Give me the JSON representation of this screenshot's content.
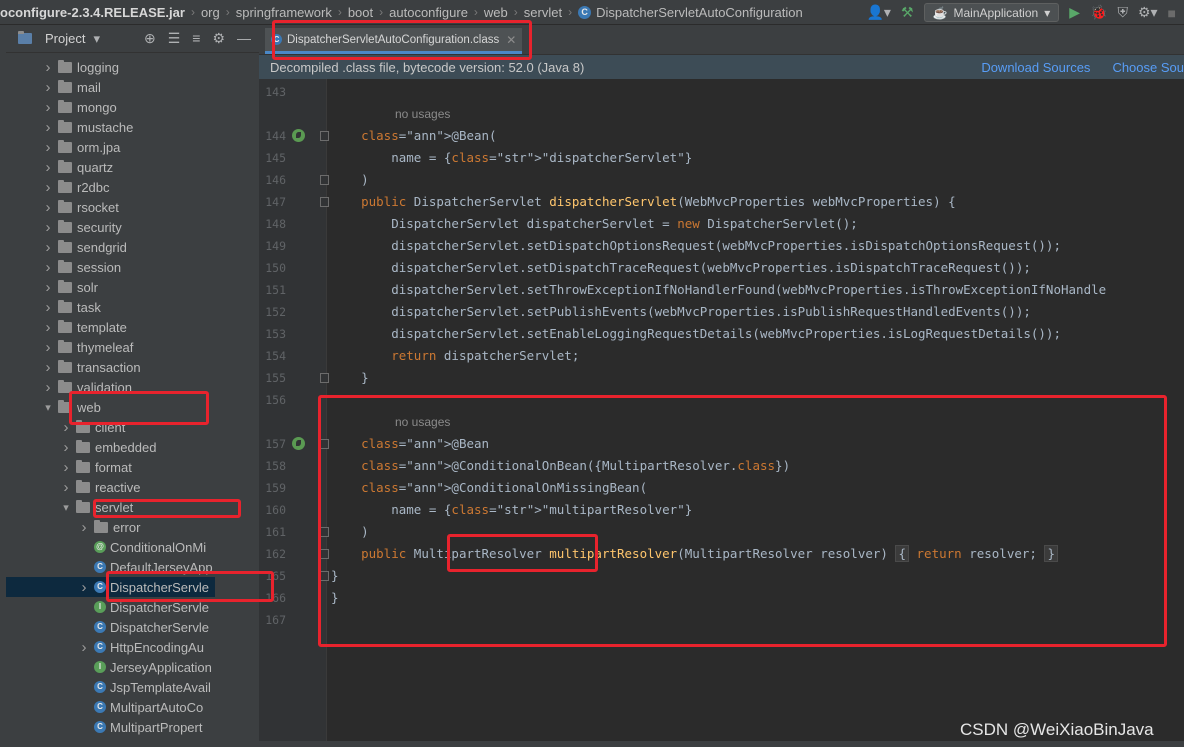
{
  "breadcrumb": [
    "oconfigure-2.3.4.RELEASE.jar",
    "org",
    "springframework",
    "boot",
    "autoconfigure",
    "web",
    "servlet",
    "DispatcherServletAutoConfiguration"
  ],
  "toolbar": {
    "run_config": "MainApplication"
  },
  "project_panel": {
    "title": "Project",
    "tree": [
      {
        "label": "logging",
        "type": "folder",
        "level": 1,
        "arrow": "right"
      },
      {
        "label": "mail",
        "type": "folder",
        "level": 1,
        "arrow": "right"
      },
      {
        "label": "mongo",
        "type": "folder",
        "level": 1,
        "arrow": "right"
      },
      {
        "label": "mustache",
        "type": "folder",
        "level": 1,
        "arrow": "right"
      },
      {
        "label": "orm.jpa",
        "type": "folder",
        "level": 1,
        "arrow": "right"
      },
      {
        "label": "quartz",
        "type": "folder",
        "level": 1,
        "arrow": "right"
      },
      {
        "label": "r2dbc",
        "type": "folder",
        "level": 1,
        "arrow": "right"
      },
      {
        "label": "rsocket",
        "type": "folder",
        "level": 1,
        "arrow": "right"
      },
      {
        "label": "security",
        "type": "folder",
        "level": 1,
        "arrow": "right"
      },
      {
        "label": "sendgrid",
        "type": "folder",
        "level": 1,
        "arrow": "right"
      },
      {
        "label": "session",
        "type": "folder",
        "level": 1,
        "arrow": "right"
      },
      {
        "label": "solr",
        "type": "folder",
        "level": 1,
        "arrow": "right"
      },
      {
        "label": "task",
        "type": "folder",
        "level": 1,
        "arrow": "right"
      },
      {
        "label": "template",
        "type": "folder",
        "level": 1,
        "arrow": "right"
      },
      {
        "label": "thymeleaf",
        "type": "folder",
        "level": 1,
        "arrow": "right"
      },
      {
        "label": "transaction",
        "type": "folder",
        "level": 1,
        "arrow": "right"
      },
      {
        "label": "validation",
        "type": "folder",
        "level": 1,
        "arrow": "right"
      },
      {
        "label": "web",
        "type": "folder",
        "level": 1,
        "arrow": "down"
      },
      {
        "label": "client",
        "type": "folder",
        "level": 2,
        "arrow": "right"
      },
      {
        "label": "embedded",
        "type": "folder",
        "level": 2,
        "arrow": "right"
      },
      {
        "label": "format",
        "type": "folder",
        "level": 2,
        "arrow": "right"
      },
      {
        "label": "reactive",
        "type": "folder",
        "level": 2,
        "arrow": "right"
      },
      {
        "label": "servlet",
        "type": "folder",
        "level": 2,
        "arrow": "down"
      },
      {
        "label": "error",
        "type": "folder",
        "level": 3,
        "arrow": "right"
      },
      {
        "label": "ConditionalOnMi",
        "type": "annotation",
        "level": 3,
        "arrow": ""
      },
      {
        "label": "DefaultJerseyApp",
        "type": "class",
        "level": 3,
        "arrow": ""
      },
      {
        "label": "DispatcherServle",
        "type": "class",
        "level": 3,
        "arrow": "right",
        "selected": true
      },
      {
        "label": "DispatcherServle",
        "type": "interface",
        "level": 3,
        "arrow": ""
      },
      {
        "label": "DispatcherServle",
        "type": "class",
        "level": 3,
        "arrow": ""
      },
      {
        "label": "HttpEncodingAu",
        "type": "class",
        "level": 3,
        "arrow": "right"
      },
      {
        "label": "JerseyApplication",
        "type": "interface",
        "level": 3,
        "arrow": ""
      },
      {
        "label": "JspTemplateAvail",
        "type": "class",
        "level": 3,
        "arrow": ""
      },
      {
        "label": "MultipartAutoCo",
        "type": "class",
        "level": 3,
        "arrow": ""
      },
      {
        "label": "MultipartPropert",
        "type": "class",
        "level": 3,
        "arrow": ""
      }
    ]
  },
  "tab": {
    "label": "DispatcherServletAutoConfiguration.class"
  },
  "notice": {
    "text": "Decompiled .class file, bytecode version: 52.0 (Java 8)",
    "download_sources": "Download Sources",
    "choose_sources": "Choose Sou"
  },
  "code_lines": [
    {
      "n": "143",
      "text": ""
    },
    {
      "n": "",
      "hint": "no usages"
    },
    {
      "n": "144",
      "bean": true,
      "text": "    @Bean("
    },
    {
      "n": "145",
      "text": "        name = {\"dispatcherServlet\"}"
    },
    {
      "n": "146",
      "text": "    )"
    },
    {
      "n": "147",
      "text": "    public DispatcherServlet dispatcherServlet(WebMvcProperties webMvcProperties) {"
    },
    {
      "n": "148",
      "text": "        DispatcherServlet dispatcherServlet = new DispatcherServlet();"
    },
    {
      "n": "149",
      "text": "        dispatcherServlet.setDispatchOptionsRequest(webMvcProperties.isDispatchOptionsRequest());"
    },
    {
      "n": "150",
      "text": "        dispatcherServlet.setDispatchTraceRequest(webMvcProperties.isDispatchTraceRequest());"
    },
    {
      "n": "151",
      "text": "        dispatcherServlet.setThrowExceptionIfNoHandlerFound(webMvcProperties.isThrowExceptionIfNoHandle"
    },
    {
      "n": "152",
      "text": "        dispatcherServlet.setPublishEvents(webMvcProperties.isPublishRequestHandledEvents());"
    },
    {
      "n": "153",
      "text": "        dispatcherServlet.setEnableLoggingRequestDetails(webMvcProperties.isLogRequestDetails());"
    },
    {
      "n": "154",
      "text": "        return dispatcherServlet;"
    },
    {
      "n": "155",
      "text": "    }"
    },
    {
      "n": "156",
      "text": ""
    },
    {
      "n": "",
      "hint": "no usages"
    },
    {
      "n": "157",
      "bean": true,
      "text": "    @Bean"
    },
    {
      "n": "158",
      "text": "    @ConditionalOnBean({MultipartResolver.class})"
    },
    {
      "n": "159",
      "text": "    @ConditionalOnMissingBean("
    },
    {
      "n": "160",
      "text": "        name = {\"multipartResolver\"}"
    },
    {
      "n": "161",
      "text": "    )"
    },
    {
      "n": "162",
      "text": "    public MultipartResolver multipartResolver(MultipartResolver resolver) { return resolver; }"
    },
    {
      "n": "165",
      "text": "}"
    },
    {
      "n": "166",
      "text": "}"
    },
    {
      "n": "167",
      "text": ""
    }
  ],
  "watermark": "CSDN @WeiXiaoBinJava",
  "colors": {
    "highlight": "#e8232d",
    "keyword": "#cc7832",
    "annotation": "#bbb529",
    "string": "#6a8759",
    "method": "#ffc66d",
    "link": "#589df6"
  }
}
